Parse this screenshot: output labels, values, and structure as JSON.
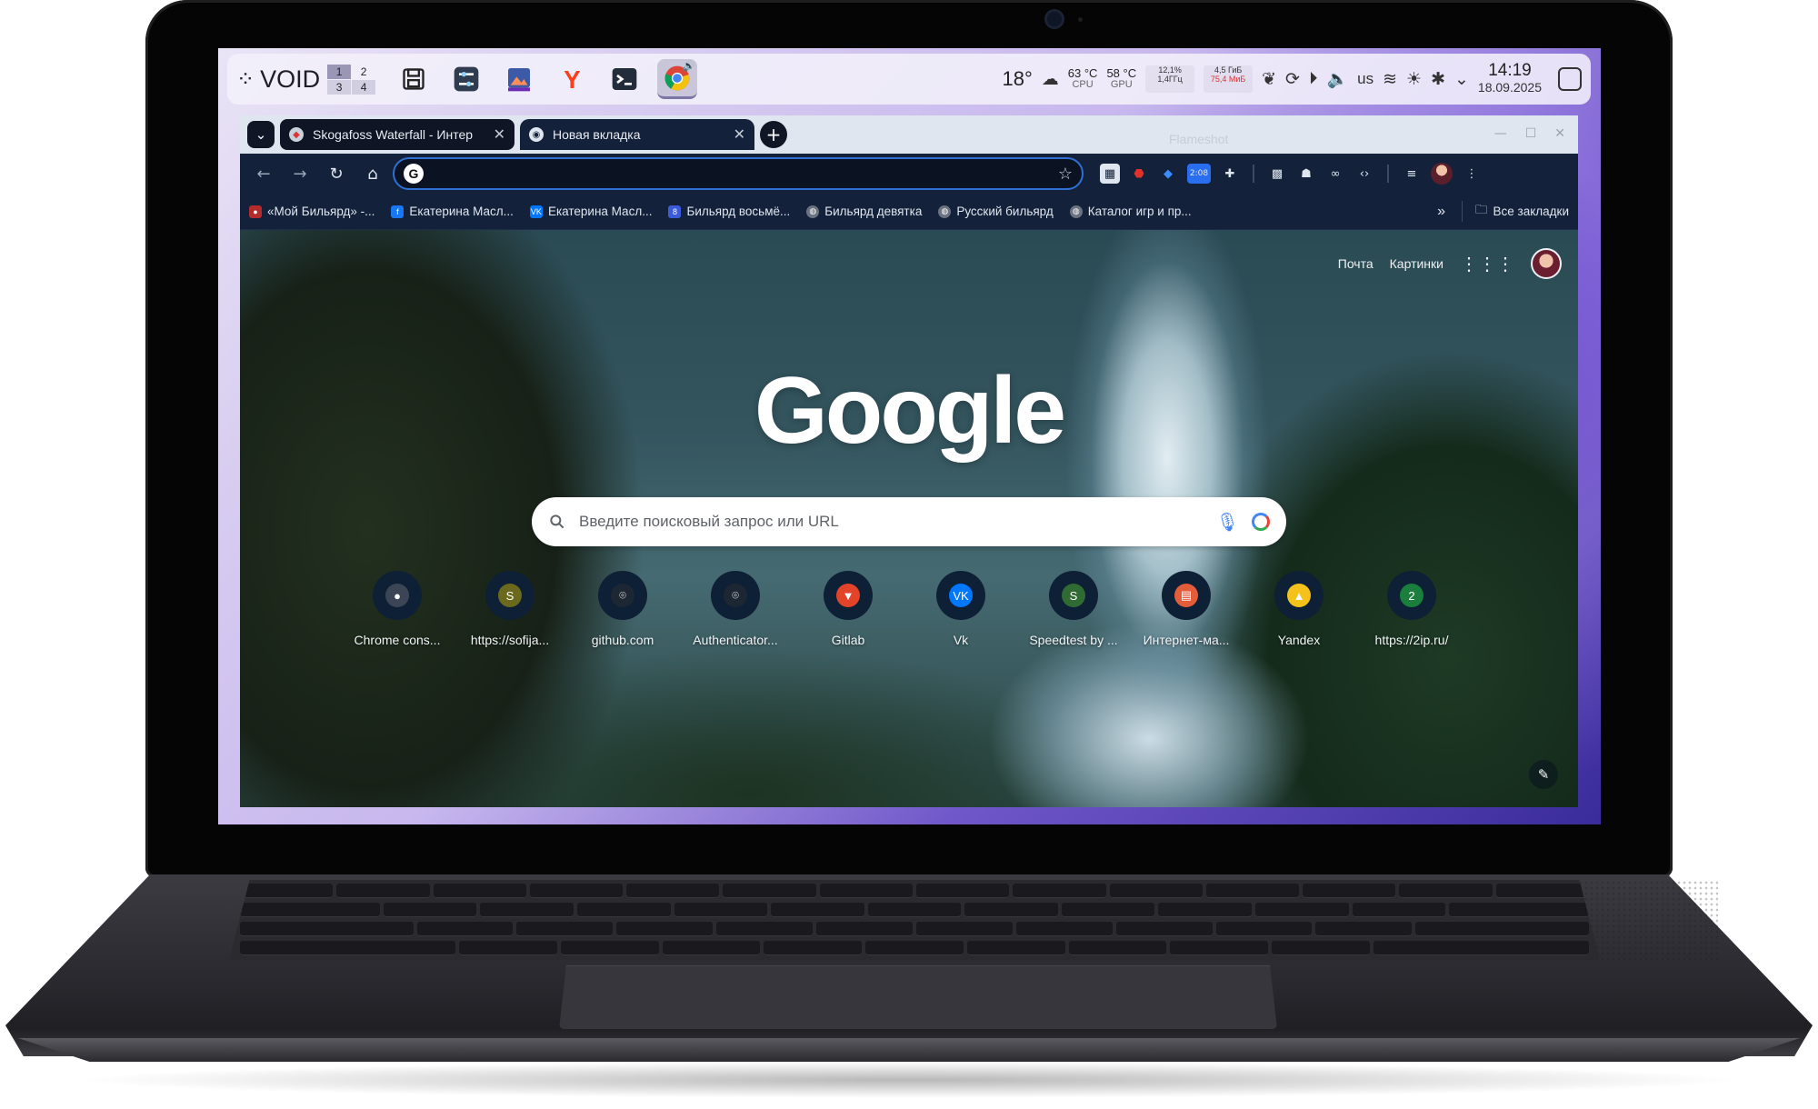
{
  "panel": {
    "logo": "VOID",
    "workspaces": [
      "1",
      "2",
      "3",
      "4"
    ],
    "apps": [
      {
        "name": "save-app-icon",
        "glyph": "💾"
      },
      {
        "name": "settings-app-icon",
        "glyph": "⚙"
      },
      {
        "name": "image-viewer-app-icon",
        "glyph": "▣"
      },
      {
        "name": "yandex-browser-app-icon",
        "glyph": "Y"
      },
      {
        "name": "terminal-app-icon",
        "glyph": ">_"
      },
      {
        "name": "chrome-app-icon",
        "glyph": "◉"
      }
    ],
    "weather_temp": "18°",
    "cpu_temp": "63 °C",
    "cpu_label": "CPU",
    "gpu_temp": "58 °C",
    "gpu_label": "GPU",
    "cpu_load_percent": "12,1%",
    "cpu_freq": "1,4ГГц",
    "mem_used": "4,5 ГиБ",
    "mem_small": "75,4 МиБ",
    "keyboard_layout": "us",
    "clock_time": "14:19",
    "clock_date": "18.09.2025"
  },
  "browser": {
    "tabs": [
      {
        "title": "Skogafoss Waterfall - Интер",
        "close": "✕"
      },
      {
        "title": "Новая вкладка",
        "close": "✕"
      }
    ],
    "omnibox_value": "",
    "extension_badge": "2:08",
    "bookmarks": [
      "«Мой Бильярд» -...",
      "Екатерина Масл...",
      "Екатерина Масл...",
      "Бильярд восьмё...",
      "Бильярд девятка",
      "Русский бильярд",
      "Каталог игр и пр..."
    ],
    "bookmarks_more": "»",
    "all_bookmarks": "Все закладки",
    "flameshot_ghost": "Flameshot"
  },
  "ntp": {
    "header_links": [
      "Почта",
      "Картинки"
    ],
    "logo": "Google",
    "search_placeholder": "Введите поисковый запрос или URL",
    "shortcuts": [
      {
        "label": "Chrome cons...",
        "icon": "●",
        "color": "#3b4556"
      },
      {
        "label": "https://sofija...",
        "icon": "S",
        "color": "#6b6a1c"
      },
      {
        "label": "github.com",
        "icon": "⌾",
        "color": "#1d2633"
      },
      {
        "label": "Authenticator...",
        "icon": "⌾",
        "color": "#1d2633"
      },
      {
        "label": "Gitlab",
        "icon": "▼",
        "color": "#e24329"
      },
      {
        "label": "Vk",
        "icon": "VK",
        "color": "#0077ff"
      },
      {
        "label": "Speedtest by ...",
        "icon": "S",
        "color": "#2f6b33"
      },
      {
        "label": "Интернет-ма...",
        "icon": "▤",
        "color": "#e35d3b"
      },
      {
        "label": "Yandex",
        "icon": "▲",
        "color": "#f4c21b"
      },
      {
        "label": "https://2ip.ru/",
        "icon": "2",
        "color": "#1a7f3c"
      }
    ]
  }
}
